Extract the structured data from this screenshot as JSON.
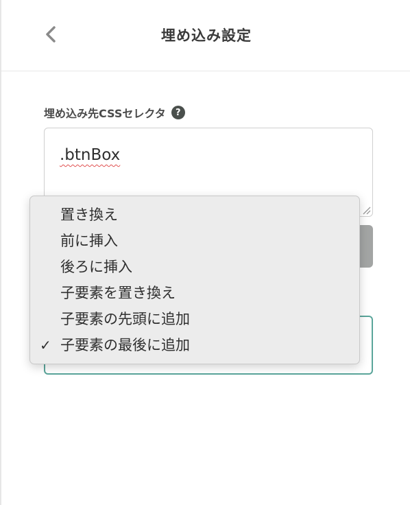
{
  "header": {
    "title": "埋め込み設定",
    "back_icon": "chevron-left-icon"
  },
  "selector_field": {
    "label": "埋め込み先CSSセレクタ",
    "help_glyph": "?",
    "value": ".btnBox"
  },
  "insert_mode": {
    "options": [
      "置き換え",
      "前に挿入",
      "後ろに挿入",
      "子要素を置き換え",
      "子要素の先頭に追加",
      "子要素の最後に追加"
    ],
    "selected": "子要素の最後に追加",
    "check_glyph": "✓"
  },
  "colors": {
    "accent": "#5aa59a",
    "button_gray": "#a3a5a4",
    "dropdown_bg": "#ececec"
  }
}
